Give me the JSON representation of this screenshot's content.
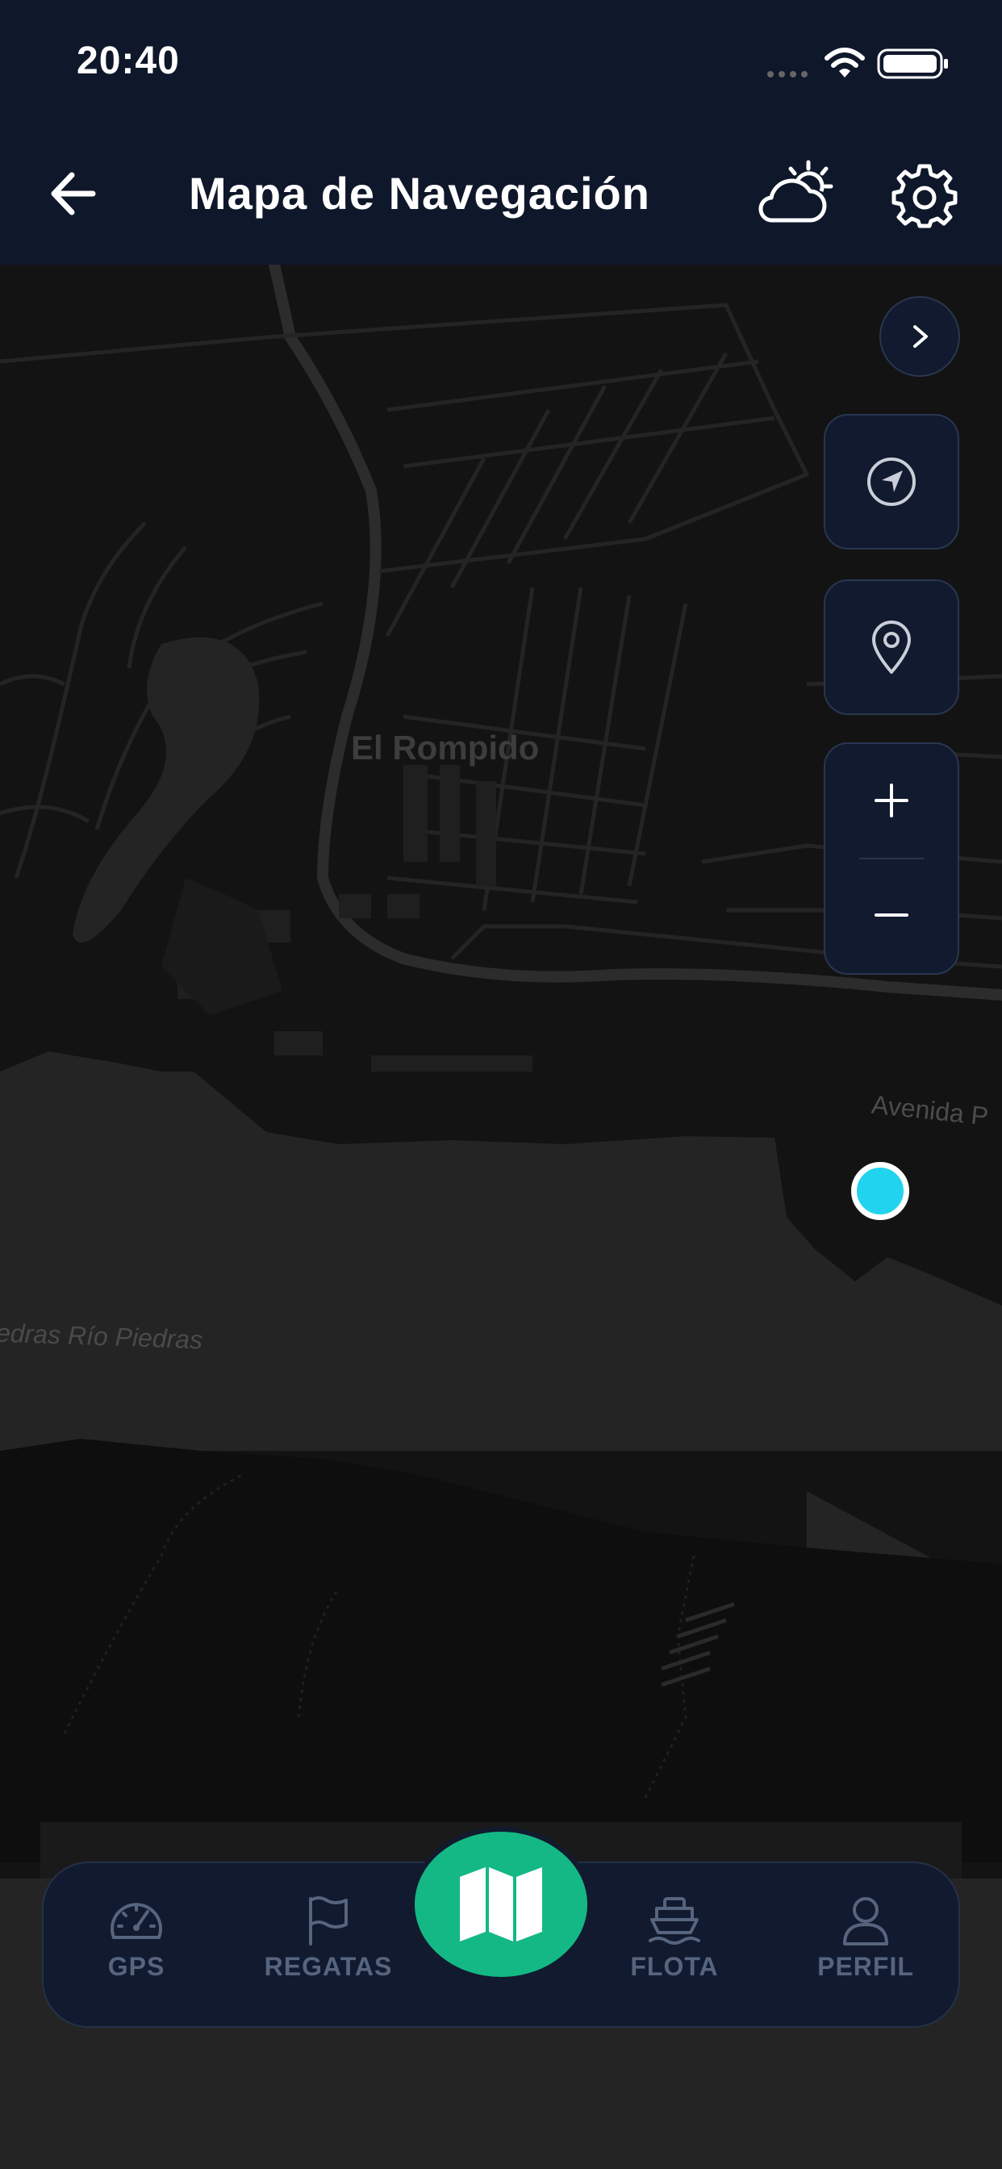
{
  "status_bar": {
    "time": "20:40"
  },
  "header": {
    "title": "Mapa de Navegación"
  },
  "map": {
    "town_label": "El Rompido",
    "river_label": "edras Río Piedras",
    "street_label": "Avenida P"
  },
  "bottom_nav": {
    "items": [
      {
        "label": "GPS",
        "icon": "speedometer-icon"
      },
      {
        "label": "REGATAS",
        "icon": "flag-icon"
      },
      {
        "label": "",
        "icon": "map-icon",
        "active": true
      },
      {
        "label": "FLOTA",
        "icon": "boat-icon"
      },
      {
        "label": "PERFIL",
        "icon": "user-icon"
      }
    ]
  },
  "colors": {
    "header_bg": "#0f172a",
    "map_bg": "#131313",
    "accent_green": "#14b884",
    "location_dot": "#22d3ee",
    "nav_inactive": "#56647e"
  }
}
